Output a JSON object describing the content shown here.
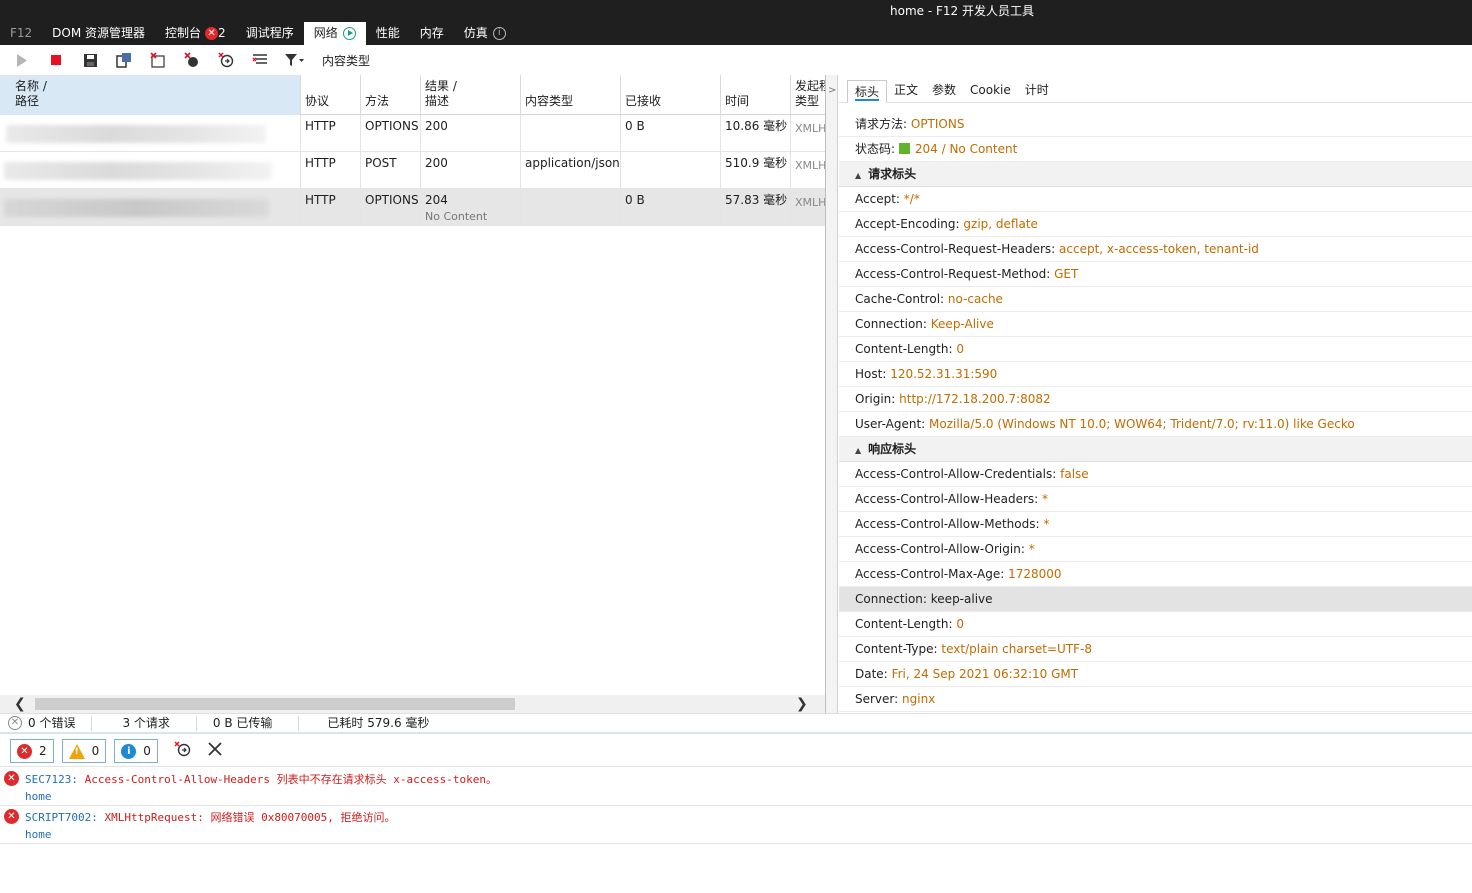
{
  "window": {
    "title": "home - F12 开发人员工具"
  },
  "menu": {
    "items": [
      {
        "label": "F12"
      },
      {
        "label": "DOM 资源管理器"
      },
      {
        "label": "控制台",
        "error_count": "2"
      },
      {
        "label": "调试程序"
      },
      {
        "label": "网络"
      },
      {
        "label": "性能"
      },
      {
        "label": "内存"
      },
      {
        "label": "仿真"
      }
    ]
  },
  "toolbar": {
    "filter_label": "内容类型"
  },
  "grid": {
    "columns": [
      "名称 /",
      "路径",
      "协议",
      "方法",
      "结果 /",
      "描述",
      "内容类型",
      "已接收",
      "时间",
      "发起程",
      "类型"
    ],
    "rows": [
      {
        "protocol": "HTTP",
        "method": "OPTIONS",
        "result": "200",
        "description": "",
        "content_type": "",
        "received": "0 B",
        "time": "10.86 毫秒",
        "initiator": "XMLH"
      },
      {
        "protocol": "HTTP",
        "method": "POST",
        "result": "200",
        "description": "",
        "content_type": "application/json",
        "received": "",
        "time": "510.9 毫秒",
        "initiator": "XMLH"
      },
      {
        "protocol": "HTTP",
        "method": "OPTIONS",
        "result": "204",
        "description": "No Content",
        "content_type": "",
        "received": "0 B",
        "time": "57.83 毫秒",
        "initiator": "XMLH"
      }
    ]
  },
  "details": {
    "tabs": [
      "标头",
      "正文",
      "参数",
      "Cookie",
      "计时"
    ],
    "request_method_label": "请求方法:",
    "request_method": "OPTIONS",
    "status_label": "状态码:",
    "status": "204 / No Content",
    "request_headers_title": "请求标头",
    "request_headers": [
      {
        "name": "Accept:",
        "value": "*/*"
      },
      {
        "name": "Accept-Encoding:",
        "value": "gzip, deflate"
      },
      {
        "name": "Access-Control-Request-Headers:",
        "value": "accept, x-access-token, tenant-id"
      },
      {
        "name": "Access-Control-Request-Method:",
        "value": "GET"
      },
      {
        "name": "Cache-Control:",
        "value": "no-cache"
      },
      {
        "name": "Connection:",
        "value": "Keep-Alive"
      },
      {
        "name": "Content-Length:",
        "value": "0"
      },
      {
        "name": "Host:",
        "value": "120.52.31.31:590"
      },
      {
        "name": "Origin:",
        "value": "http://172.18.200.7:8082"
      },
      {
        "name": "User-Agent:",
        "value": "Mozilla/5.0 (Windows NT 10.0; WOW64; Trident/7.0; rv:11.0) like Gecko"
      }
    ],
    "response_headers_title": "响应标头",
    "response_headers": [
      {
        "name": "Access-Control-Allow-Credentials:",
        "value": "false"
      },
      {
        "name": "Access-Control-Allow-Headers:",
        "value": "*"
      },
      {
        "name": "Access-Control-Allow-Methods:",
        "value": "*"
      },
      {
        "name": "Access-Control-Allow-Origin:",
        "value": "*"
      },
      {
        "name": "Access-Control-Max-Age:",
        "value": "1728000"
      },
      {
        "name": "Connection:",
        "value": "keep-alive"
      },
      {
        "name": "Content-Length:",
        "value": "0"
      },
      {
        "name": "Content-Type:",
        "value": "text/plain charset=UTF-8"
      },
      {
        "name": "Date:",
        "value": "Fri, 24 Sep 2021 06:32:10 GMT"
      },
      {
        "name": "Server:",
        "value": "nginx"
      }
    ]
  },
  "statusbar": {
    "errors": "0 个错误",
    "requests": "3 个请求",
    "transferred": "0 B 已传输",
    "elapsed": "已耗时 579.6 毫秒"
  },
  "console": {
    "error_count": "2",
    "warning_count": "0",
    "info_count": "0",
    "messages": [
      {
        "code": "SEC7123:",
        "text": "Access-Control-Allow-Headers 列表中不存在请求标头 x-access-token。",
        "source": "home"
      },
      {
        "code": "SCRIPT7002:",
        "text": "XMLHttpRequest: 网络错误 0x80070005, 拒绝访问。",
        "source": "home"
      }
    ]
  },
  "colors": {
    "header_value": "#c26b00",
    "error": "#e0292b",
    "link": "#1f6fb8",
    "status_ok": "#62b32c"
  },
  "icons": [
    "play-icon",
    "stop-icon",
    "save-icon",
    "clear-cache-icon",
    "clear-entries-icon",
    "clear-cookies-icon",
    "always-refresh-icon",
    "clear-session-icon",
    "filter-icon",
    "close-icon"
  ]
}
